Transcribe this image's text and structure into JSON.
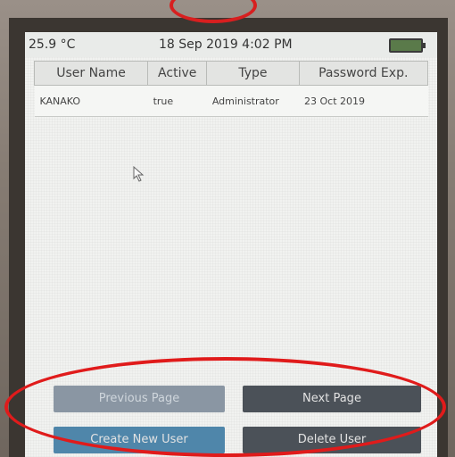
{
  "status": {
    "temperature": "25.9 °C",
    "datetime": "18 Sep 2019 4:02 PM"
  },
  "table": {
    "headers": [
      "User Name",
      "Active",
      "Type",
      "Password Exp."
    ],
    "rows": [
      [
        "KANAKO",
        "true",
        "Administrator",
        "23 Oct 2019"
      ]
    ]
  },
  "buttons": {
    "previous_page": "Previous Page",
    "next_page": "Next Page",
    "create_new_user": "Create New User",
    "delete_user": "Delete User"
  },
  "colors": {
    "annotation": "#e01b1b",
    "button_dark": "#4b5158",
    "button_blue": "#4f86aa",
    "button_disabled": "#8a96a3"
  },
  "icons": [
    "battery-icon",
    "cursor-icon"
  ]
}
